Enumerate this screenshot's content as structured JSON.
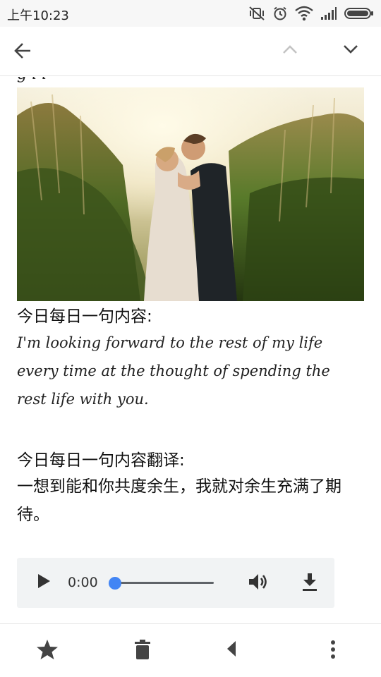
{
  "status_bar": {
    "time": "上午10:23",
    "icons": [
      "vibrate-off-icon",
      "alarm-icon",
      "wifi-icon",
      "signal-icon",
      "battery-icon"
    ]
  },
  "toolbar": {
    "icons": [
      "back-arrow-icon",
      "chevron-up-icon",
      "chevron-down-icon"
    ]
  },
  "content": {
    "clipped_text": "g i i",
    "daily_label": "今日每日一句内容:",
    "quote": "I'm looking forward to the rest of my life every time at the thought of spending the rest life with you.",
    "translation_label": "今日每日一句内容翻译:",
    "translation": "一想到能和你共度余生，我就对余生充满了期待。"
  },
  "audio": {
    "time": "0:00",
    "progress": 0,
    "accent_color": "#4285f4",
    "icons": [
      "play-icon",
      "volume-icon",
      "download-icon"
    ]
  },
  "bottom_bar": {
    "icons": [
      "star-icon",
      "delete-icon",
      "reply-icon",
      "more-vert-icon"
    ]
  }
}
